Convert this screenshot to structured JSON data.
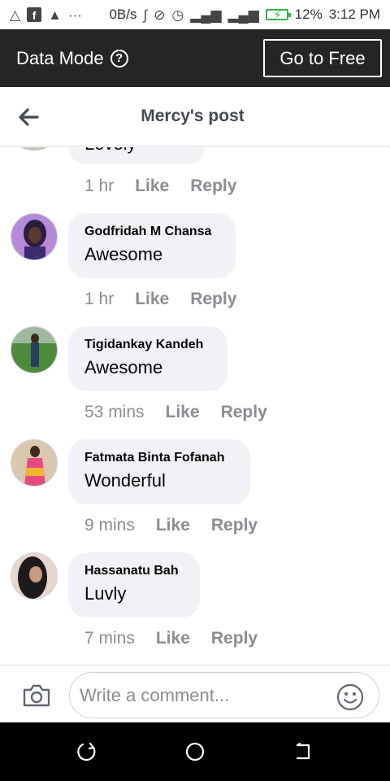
{
  "status_bar": {
    "network_speed": "0B/s",
    "battery_percent": "12%",
    "time": "3:12 PM",
    "icons": [
      "alert-triangle-icon",
      "facebook-icon",
      "warning-icon",
      "more-icon",
      "bluetooth-icon",
      "rotate-icon",
      "alarm-icon",
      "signal-icon",
      "signal-icon",
      "battery-charging-icon"
    ],
    "ellipsis": "···"
  },
  "data_bar": {
    "label": "Data Mode",
    "button_label": "Go to Free"
  },
  "header": {
    "title": "Mercy's post"
  },
  "partial_comment": {
    "text": "Lovely",
    "time": "1 hr",
    "like": "Like",
    "reply": "Reply"
  },
  "comments": [
    {
      "author": "Godfridah M Chansa",
      "text": "Awesome",
      "time": "1 hr",
      "like": "Like",
      "reply": "Reply"
    },
    {
      "author": "Tigidankay Kandeh",
      "text": "Awesome",
      "time": "53 mins",
      "like": "Like",
      "reply": "Reply"
    },
    {
      "author": "Fatmata Binta Fofanah",
      "text": "Wonderful",
      "time": "9 mins",
      "like": "Like",
      "reply": "Reply"
    },
    {
      "author": "Hassanatu Bah",
      "text": "Luvly",
      "time": "7 mins",
      "like": "Like",
      "reply": "Reply"
    }
  ],
  "composer": {
    "placeholder": "Write a comment..."
  },
  "colors": {
    "data_bar": "#242527",
    "bubble": "#f0f2f5",
    "meta_text": "#8a8d91"
  }
}
